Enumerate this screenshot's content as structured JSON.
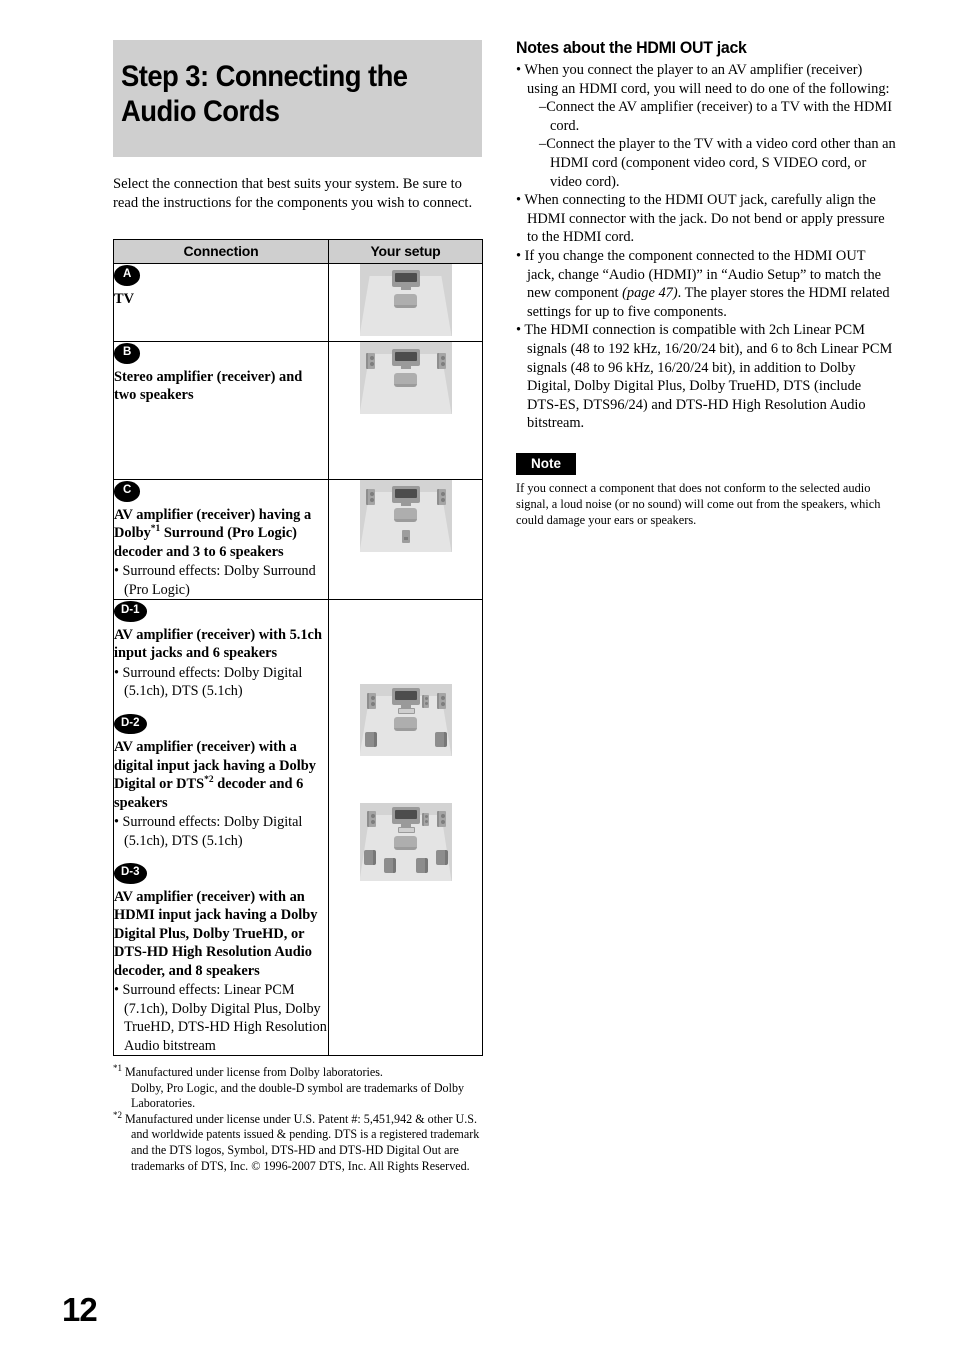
{
  "page_number": "12",
  "left": {
    "step_title": "Step 3: Connecting the Audio Cords",
    "intro": "Select the connection that best suits your system. Be sure to read the instructions for the components you wish to connect.",
    "table": {
      "headers": [
        "Connection",
        "Your setup"
      ],
      "rows": [
        {
          "badge": "A",
          "title": "TV",
          "bullets": []
        },
        {
          "badge": "B",
          "title": "Stereo amplifier (receiver) and two speakers",
          "bullets": []
        },
        {
          "badge": "C",
          "title_part1": "AV amplifier (receiver) having a Dolby",
          "title_sup": "*1",
          "title_part2": " Surround (Pro Logic) decoder and 3 to 6 speakers",
          "bullets": [
            "Surround effects: Dolby Surround (Pro Logic)"
          ]
        }
      ],
      "d_row": {
        "blocks": [
          {
            "badge": "D-1",
            "title": "AV amplifier (receiver) with 5.1ch input jacks and 6 speakers",
            "bullets": [
              "Surround effects: Dolby Digital (5.1ch), DTS (5.1ch)"
            ]
          },
          {
            "badge": "D-2",
            "title_part1": "AV amplifier (receiver) with a digital input jack having a Dolby Digital or DTS",
            "title_sup": "*2",
            "title_part2": " decoder and 6 speakers",
            "bullets": [
              "Surround effects: Dolby Digital (5.1ch), DTS (5.1ch)"
            ]
          },
          {
            "badge": "D-3",
            "title": "AV amplifier (receiver) with an HDMI input jack having a Dolby Digital Plus, Dolby TrueHD, or DTS-HD High Resolution Audio decoder, and 8 speakers",
            "bullets": [
              "Surround effects: Linear PCM (7.1ch), Dolby Digital Plus, Dolby TrueHD, DTS-HD High Resolution Audio bitstream"
            ]
          }
        ]
      }
    },
    "footnotes": [
      {
        "mark": "*1",
        "line1": "Manufactured under license from Dolby laboratories.",
        "line2": "Dolby, Pro Logic, and the double-D symbol are trademarks of Dolby Laboratories."
      },
      {
        "mark": "*2",
        "line1": "Manufactured under license under U.S. Patent #: 5,451,942 & other U.S. and worldwide patents issued & pending. DTS is a registered trademark and the DTS logos, Symbol, DTS-HD and DTS-HD Digital Out are trademarks of DTS, Inc. © 1996-2007 DTS, Inc. All Rights Reserved.",
        "line2": ""
      }
    ]
  },
  "right": {
    "heading": "Notes about the HDMI OUT jack",
    "bullet1": "When you connect the player to an AV amplifier (receiver) using an HDMI cord, you will need to do one of the following:",
    "sub1": "Connect the AV amplifier (receiver) to a TV with the HDMI cord.",
    "sub2": "Connect the player to the TV with a video cord other than an HDMI cord (component video cord, S VIDEO cord, or video cord).",
    "bullet2": "When connecting to the HDMI OUT jack, carefully align the HDMI connector with the jack. Do not bend or apply pressure to the HDMI cord.",
    "bullet3_a": "If you change the component connected to the HDMI OUT jack, change “Audio (HDMI)” in “Audio Setup” to match the new component ",
    "bullet3_ital": "(page 47)",
    "bullet3_b": ". The player stores the HDMI related settings for up to five components.",
    "bullet4": "The HDMI connection is compatible with 2ch Linear PCM signals (48 to 192 kHz, 16/20/24 bit), and 6 to 8ch Linear PCM signals (48 to 96 kHz, 16/20/24 bit), in addition to Dolby Digital, Dolby Digital Plus, Dolby TrueHD, DTS (include DTS-ES, DTS96/24) and DTS-HD High Resolution Audio bitstream.",
    "note_label": "Note",
    "note_body": "If you connect a component that does not conform to the selected audio signal, a loud noise (or no sound) will come out from the speakers, which could damage your ears or speakers."
  },
  "colors": {
    "banner_gray": "#cfcfcf",
    "header_gray": "#cfcfcf",
    "badge_black": "#000000",
    "diagram_wall": "#d3d3d3",
    "diagram_floor": "#e4e4e4"
  }
}
